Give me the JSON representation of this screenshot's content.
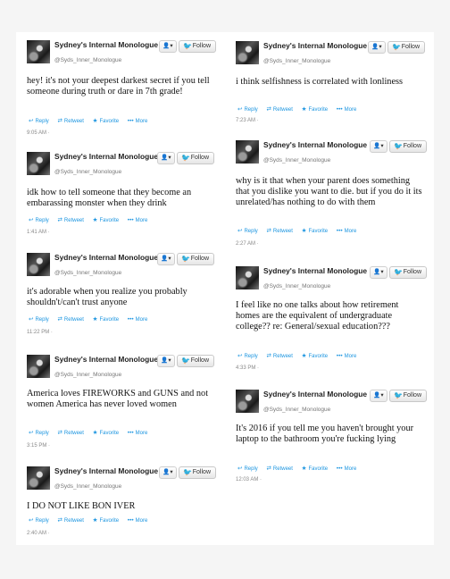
{
  "buttons": {
    "menu": "👤▾",
    "follow": "Follow",
    "reply": "Reply",
    "retweet": "Retweet",
    "favorite": "Favorite",
    "more": "More"
  },
  "user": {
    "name": "Sydney's Internal Monologue",
    "handle": "@Syds_Inner_Monologue"
  },
  "icons": {
    "bird": "twitter-bird-icon",
    "reply": "reply-arrow-icon",
    "retweet": "retweet-icon",
    "favorite": "star-icon",
    "more": "ellipsis-icon"
  },
  "colors": {
    "accent": "#1b95e0",
    "follow_bird": "#2aa3ef"
  },
  "tweets": [
    {
      "text": "hey! it's not your deepest darkest secret if you tell someone during truth or dare in 7th grade!",
      "time": "9:05 AM ·"
    },
    {
      "text": "i think selfishness is correlated with lonliness",
      "time": "7:23 AM ·"
    },
    {
      "text": "idk how to tell someone that they become an embarassing monster when they drink",
      "time": "1:41 AM ·"
    },
    {
      "text": "why is it that when your parent does something that you dislike you want to die. but if you do it its unrelated/has nothing to do with them",
      "time": "2:27 AM ·"
    },
    {
      "text": "it's adorable when you realize you probably shouldn't/can't trust anyone",
      "time": "11:22 PM ·"
    },
    {
      "text": "I feel like no one talks about how retirement homes are the equivalent of undergraduate college?? re: General/sexual education???",
      "time": "4:33 PM ·"
    },
    {
      "text": "America loves FIREWORKS and GUNS and not women America has never loved women",
      "time": "3:15 PM ·"
    },
    {
      "text": "It's 2016 if you tell me you haven't brought your laptop to the bathroom you're fucking lying",
      "time": "12:03 AM ·"
    },
    {
      "text": "I DO NOT LIKE BON IVER",
      "time": "2:40 AM ·"
    }
  ]
}
